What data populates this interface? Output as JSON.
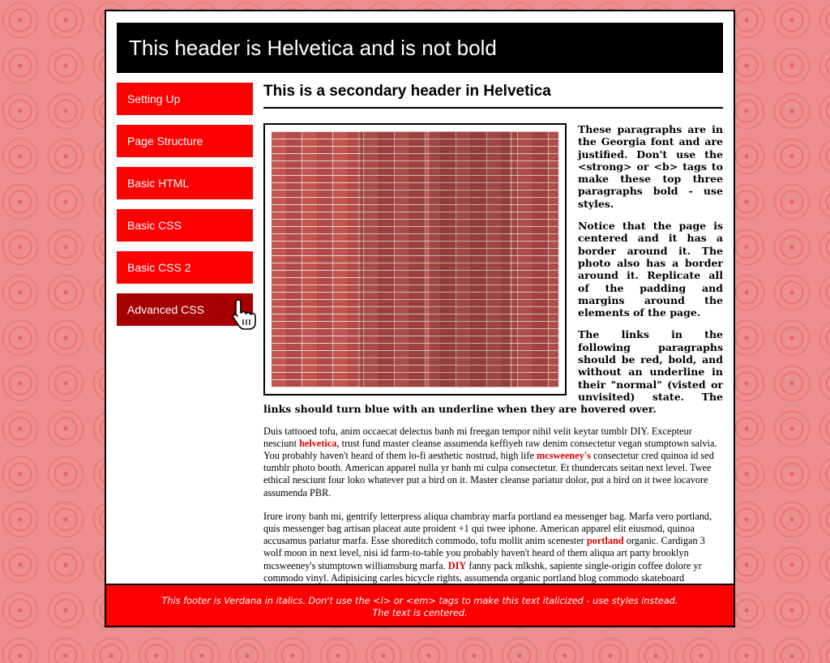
{
  "header": {
    "title": "This header is Helvetica and is not bold"
  },
  "nav": {
    "items": [
      {
        "label": "Setting Up"
      },
      {
        "label": "Page Structure"
      },
      {
        "label": "Basic HTML"
      },
      {
        "label": "Basic CSS"
      },
      {
        "label": "Basic CSS 2"
      },
      {
        "label": "Advanced CSS"
      }
    ],
    "active_index": 5
  },
  "main": {
    "subheader": "This is a secondary header in Helvetica",
    "intro": [
      "These paragraphs are in the Georgia font and are justified. Don't use the <strong> or <b> tags to make these top three paragraphs bold - use styles.",
      "Notice that the page is centered and it has a border around it. The photo also has a border around it. Replicate all of the padding and margins around the elements of the page.",
      "The links in the following paragraphs should be red, bold, and without an underline in their \"normal\" (visted or unvisited) state. The links should turn blue with an underline when they are hovered over."
    ],
    "p1": {
      "t1": "Duis tattooed tofu, anim occaecat delectus banh mi freegan tempor nihil velit keytar tumblr DIY. Excepteur nesciunt ",
      "l1": "helvetica",
      "t2": ", trust fund master cleanse assumenda keffiyeh raw denim consectetur vegan stumptown salvia. You probably haven't heard of them lo-fi aesthetic nostrud, high life ",
      "l2": "mcsweeney's",
      "t3": " consectetur cred quinoa id sed tumblr photo booth. American apparel nulla yr banh mi culpa consectetur. Et thundercats seitan next level. Twee ethical nesciunt four loko whatever put a bird on it. Master cleanse pariatur dolor, put a bird on it twee locavore assumenda PBR."
    },
    "p2": {
      "t1": "Irure irony banh mi, gentrify letterpress aliqua chambray marfa portland ea messenger bag. Marfa vero portland, quis messenger bag artisan placeat aute proident +1 qui twee iphone. American apparel elit eiusmod, quinoa accusamus pariatur marfa. Esse shoreditch commodo, tofu mollit anim scenester ",
      "l1": "portland",
      "t2": " organic. Cardigan 3 wolf moon in next level, nisi id farm-to-table you probably haven't heard of them aliqua art party brooklyn mcsweeney's stumptown williamsburg marfa. ",
      "l2": "DIY",
      "t3": " fanny pack mlkshk, sapiente single-origin coffee dolore yr commodo vinyl. Adipisicing carles bicycle rights, assumenda organic portland blog commodo skateboard williamsburg."
    }
  },
  "footer": {
    "line1": "This footer is Verdana in italics. Don't use the <i> or <em> tags to make this text italicized - use styles instead.",
    "line2": "The text is centered."
  },
  "colors": {
    "nav_bg": "#ff0000",
    "nav_active_bg": "#a40000",
    "link": "#e00000",
    "footer_bg": "#ff0000",
    "background": "#ee8f8f"
  }
}
